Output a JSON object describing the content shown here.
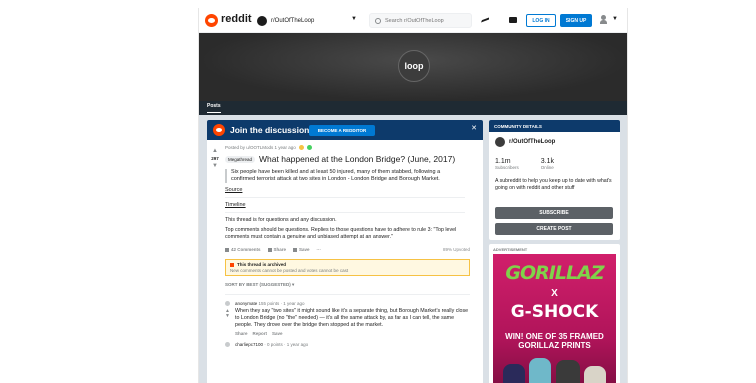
{
  "nav": {
    "logo_text": "reddit",
    "subreddit": "r/OutOfTheLoop",
    "search_placeholder": "Search r/OutOfTheLoop",
    "login_label": "LOG IN",
    "signup_label": "SIGN UP"
  },
  "banner": {
    "logo_text": "loop"
  },
  "tabs": {
    "posts_label": "Posts"
  },
  "join": {
    "title": "Join the discussion",
    "button_label": "BECOME A REDDITOR"
  },
  "post": {
    "score": "297",
    "meta": "Posted by u/OOTLMods 1 year ago",
    "flair": "Megathread",
    "title": "What happened at the London Bridge? (June, 2017)",
    "quote": "Six people have been killed and at least 50 injured, many of them stabbed, following a confirmed terrorist attack at two sites in London - London Bridge and Borough Market.",
    "source_link": "Source",
    "timeline_link": "Timeline",
    "text1": "This thread is for questions and any discussion.",
    "text2": "Top comments should be questions. Replies to those questions have to adhere to rule 3: \"Top level comments must contain a genuine and unbiased attempt at an answer.\"",
    "actions": {
      "comments": "42 Comments",
      "share": "Share",
      "save": "Save",
      "more": "···",
      "upvoted": "89% Upvoted"
    },
    "archived_title": "This thread is archived",
    "archived_text": "New comments cannot be posted and votes cannot be cast",
    "sort_label": "SORT BY",
    "sort_value": "BEST (SUGGESTED)"
  },
  "comments": [
    {
      "author": "anonymate",
      "meta": "155 points · 1 year ago",
      "text": "When they say \"two sites\" it might sound like it's a separate thing, but Borough Market's really close to London Bridge (no \"the\" needed) — it's all the same attack by, as far as I can tell, the same people. They drove over the bridge then stopped at the market.",
      "actions": [
        "Share",
        "Report",
        "Save"
      ]
    },
    {
      "author": "charliepc7100",
      "meta": "· 0 points · 1 year ago",
      "text": "",
      "actions": []
    }
  ],
  "community": {
    "header": "COMMUNITY DETAILS",
    "name": "r/OutOfTheLoop",
    "subscribers_count": "1.1m",
    "subscribers_label": "Subscribers",
    "online_count": "3.1k",
    "online_label": "Online",
    "description": "A subreddit to help you keep up to date with what's going on with reddit and other stuff",
    "subscribe_label": "SUBSCRIBE",
    "create_post_label": "CREATE POST"
  },
  "ad": {
    "label": "ADVERTISEMENT",
    "brand1": "GORILLAZ",
    "x": "X",
    "brand2": "G-SHOCK",
    "promo": "WIN! ONE OF 35 FRAMED GORILLAZ PRINTS"
  },
  "colors": {
    "reddit_orange": "#ff4500",
    "blue": "#0079d3",
    "dark_banner": "#2e2e2e",
    "join_bar": "#0d3a6b",
    "ad_pink": "#d11f6b"
  },
  "icons": [
    "reddit-logo-icon",
    "subreddit-icon",
    "chevron-down-icon",
    "search-icon",
    "trending-icon",
    "stats-icon",
    "chat-icon",
    "user-icon",
    "close-icon",
    "upvote-icon",
    "downvote-icon",
    "comment-icon",
    "share-icon",
    "save-icon",
    "archive-icon"
  ]
}
